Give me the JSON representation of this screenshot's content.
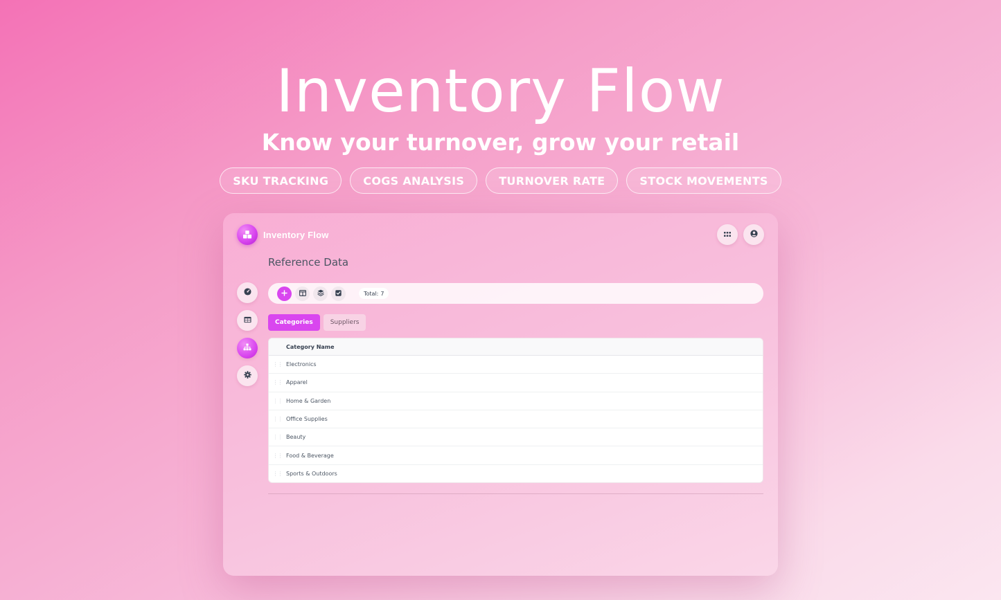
{
  "hero": {
    "title": "Inventory Flow",
    "subtitle": "Know your turnover, grow your retail",
    "pills": [
      "SKU TRACKING",
      "COGS ANALYSIS",
      "TURNOVER RATE",
      "STOCK MOVEMENTS"
    ]
  },
  "app": {
    "brand_name": "Inventory Flow",
    "page_title": "Reference Data",
    "toolbar": {
      "total_label": "Total:",
      "total_value": "7"
    },
    "tabs": [
      {
        "label": "Categories",
        "active": true
      },
      {
        "label": "Suppliers",
        "active": false
      }
    ],
    "table": {
      "columns": [
        "Category Name"
      ],
      "rows": [
        "Electronics",
        "Apparel",
        "Home & Garden",
        "Office Supplies",
        "Beauty",
        "Food & Beverage",
        "Sports & Outdoors"
      ]
    },
    "icons": {
      "brand": "boxes-icon",
      "apps": "grid-icon",
      "user": "user-circle-icon",
      "nav": [
        "dashboard-icon",
        "table-icon",
        "hierarchy-icon",
        "gear-icon"
      ],
      "tools": [
        "plus-icon",
        "columns-icon",
        "layers-icon",
        "checkbox-icon"
      ]
    },
    "colors": {
      "accent": "#d946ef",
      "text": "#4b5563"
    }
  }
}
